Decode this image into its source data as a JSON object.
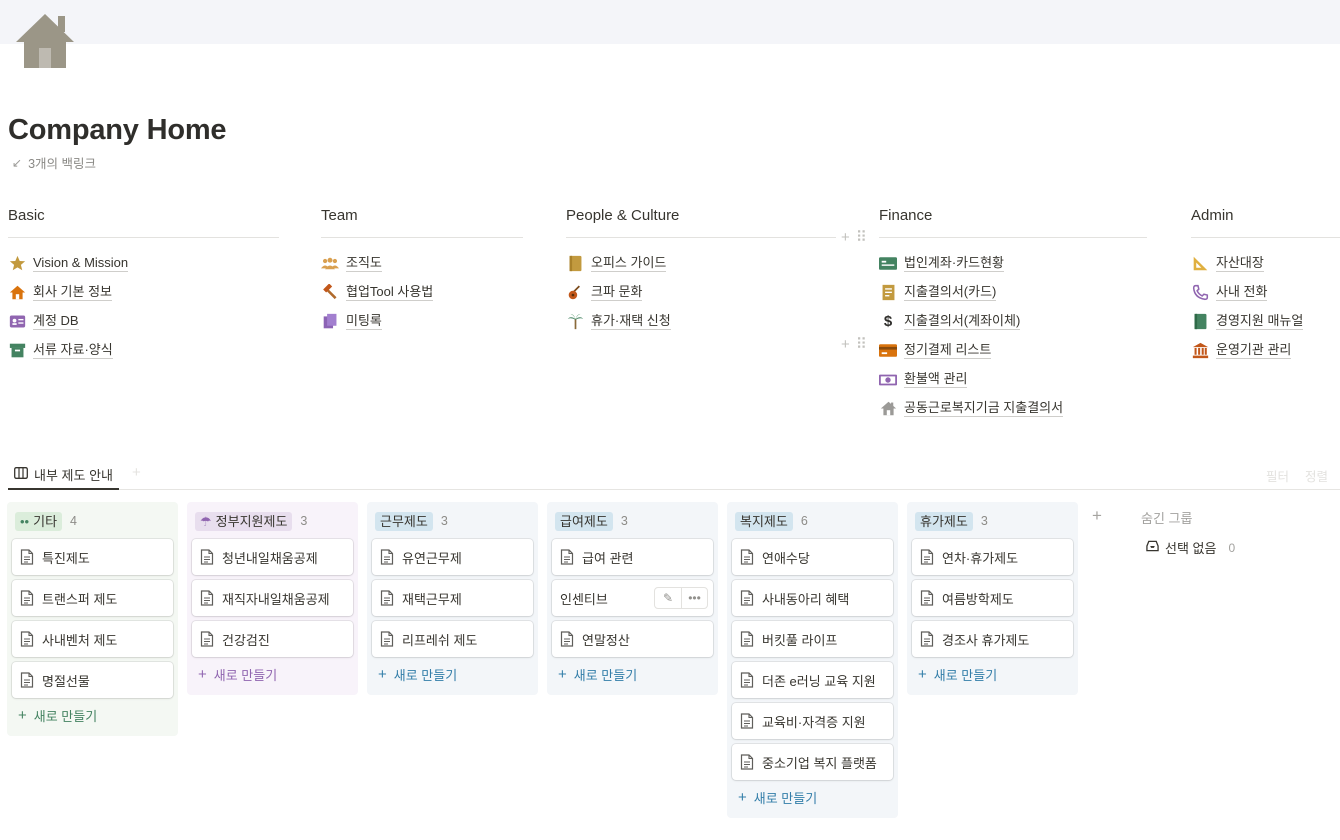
{
  "page": {
    "title": "Company Home",
    "icon": "home-icon",
    "backlinks": "3개의 백링크"
  },
  "sections": [
    {
      "heading": "Basic",
      "links": [
        {
          "label": "Vision & Mission",
          "icon": "star-icon"
        },
        {
          "label": "회사 기본 정보",
          "icon": "house-icon"
        },
        {
          "label": "계정 DB",
          "icon": "id-card-icon"
        },
        {
          "label": "서류 자료·양식",
          "icon": "archive-box-icon"
        }
      ]
    },
    {
      "heading": "Team",
      "links": [
        {
          "label": "조직도",
          "icon": "people-icon"
        },
        {
          "label": "협업Tool 사용법",
          "icon": "hammer-icon"
        },
        {
          "label": "미팅록",
          "icon": "documents-icon"
        }
      ]
    },
    {
      "heading": "People & Culture",
      "links": [
        {
          "label": "오피스 가이드",
          "icon": "notebook-icon"
        },
        {
          "label": "크파 문화",
          "icon": "guitar-icon"
        },
        {
          "label": "휴가·재택 신청",
          "icon": "palm-tree-icon"
        }
      ]
    },
    {
      "heading": "Finance",
      "links": [
        {
          "label": "법인계좌·카드현황",
          "icon": "bank-card-icon"
        },
        {
          "label": "지출결의서(카드)",
          "icon": "receipt-icon"
        },
        {
          "label": "지출결의서(계좌이체)",
          "icon": "dollar-icon"
        },
        {
          "label": "정기결제 리스트",
          "icon": "credit-card-icon"
        },
        {
          "label": "환불액 관리",
          "icon": "money-icon"
        },
        {
          "label": "공동근로복지기금 지출결의서",
          "icon": "house-gray-icon"
        }
      ]
    },
    {
      "heading": "Admin",
      "links": [
        {
          "label": "자산대장",
          "icon": "ruler-triangle-icon"
        },
        {
          "label": "사내 전화",
          "icon": "phone-icon"
        },
        {
          "label": "경영지원 매뉴얼",
          "icon": "book-icon"
        },
        {
          "label": "운영기관 관리",
          "icon": "institution-icon"
        }
      ]
    }
  ],
  "database": {
    "view_label": "내부 제도 안내",
    "actions": {
      "filter": "필터",
      "sort": "정렬"
    },
    "new_label": "새로 만들기",
    "groups": [
      {
        "name": "기타",
        "count": "4",
        "emoji": "••",
        "bg": "#f4f8f3",
        "pill": "#dbeddb",
        "text": "#448361",
        "cards": [
          "특진제도",
          "트랜스퍼 제도",
          "사내벤처 제도",
          "명절선물"
        ]
      },
      {
        "name": "정부지원제도",
        "count": "3",
        "emoji": "☂",
        "bg": "#f8f3fa",
        "pill": "#e8deee",
        "text": "#9065b0",
        "cards": [
          "청년내일채움공제",
          "재직자내일채움공제",
          "건강검진"
        ]
      },
      {
        "name": "근무제도",
        "count": "3",
        "emoji": "",
        "bg": "#f3f6f9",
        "pill": "#d3e5ef",
        "text": "#337ea9",
        "cards": [
          "유연근무제",
          "재택근무제",
          "리프레쉬 제도"
        ]
      },
      {
        "name": "급여제도",
        "count": "3",
        "emoji": "",
        "bg": "#f3f6f9",
        "pill": "#d3e5ef",
        "text": "#337ea9",
        "cards": [
          "급여 관련",
          "인센티브",
          "연말정산"
        ]
      },
      {
        "name": "복지제도",
        "count": "6",
        "emoji": "",
        "bg": "#f3f6f9",
        "pill": "#d3e5ef",
        "text": "#337ea9",
        "cards": [
          "연애수당",
          "사내동아리 혜택",
          "버킷풀 라이프",
          "더존 e러닝 교육 지원",
          "교육비·자격증 지원",
          "중소기업 복지 플랫폼"
        ]
      },
      {
        "name": "휴가제도",
        "count": "3",
        "emoji": "",
        "bg": "#f3f6f9",
        "pill": "#d3e5ef",
        "text": "#337ea9",
        "cards": [
          "연차·휴가제도",
          "여름방학제도",
          "경조사 휴가제도"
        ]
      }
    ],
    "hidden_groups": {
      "title": "숨긴 그룹",
      "item": "선택 없음",
      "count": "0"
    }
  }
}
